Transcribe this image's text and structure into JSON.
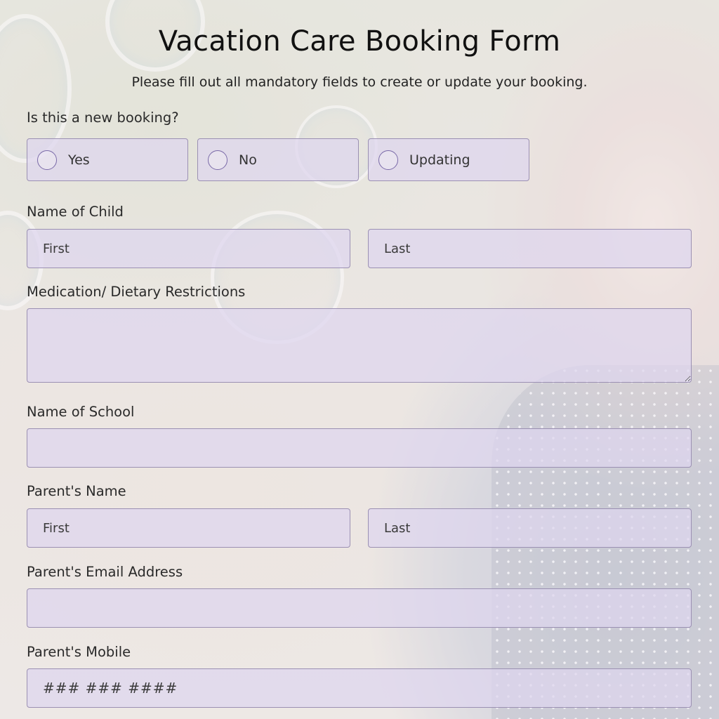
{
  "form": {
    "title": "Vacation Care Booking Form",
    "subtitle": "Please fill out all mandatory fields to create or update your booking.",
    "new_booking": {
      "label": "Is this a new booking?",
      "options": [
        "Yes",
        "No",
        "Updating"
      ]
    },
    "child_name": {
      "label": "Name of Child",
      "first_placeholder": "First",
      "last_placeholder": "Last"
    },
    "medication": {
      "label": "Medication/ Dietary Restrictions"
    },
    "school": {
      "label": "Name of School"
    },
    "parent_name": {
      "label": "Parent's Name",
      "first_placeholder": "First",
      "last_placeholder": "Last"
    },
    "parent_email": {
      "label": "Parent's Email Address"
    },
    "parent_mobile": {
      "label": "Parent's Mobile",
      "placeholder": "### ### ####"
    }
  },
  "colors": {
    "field_fill": "#ded6ee",
    "field_border": "#9b90b3",
    "radio_ring": "#7a6aa8"
  }
}
